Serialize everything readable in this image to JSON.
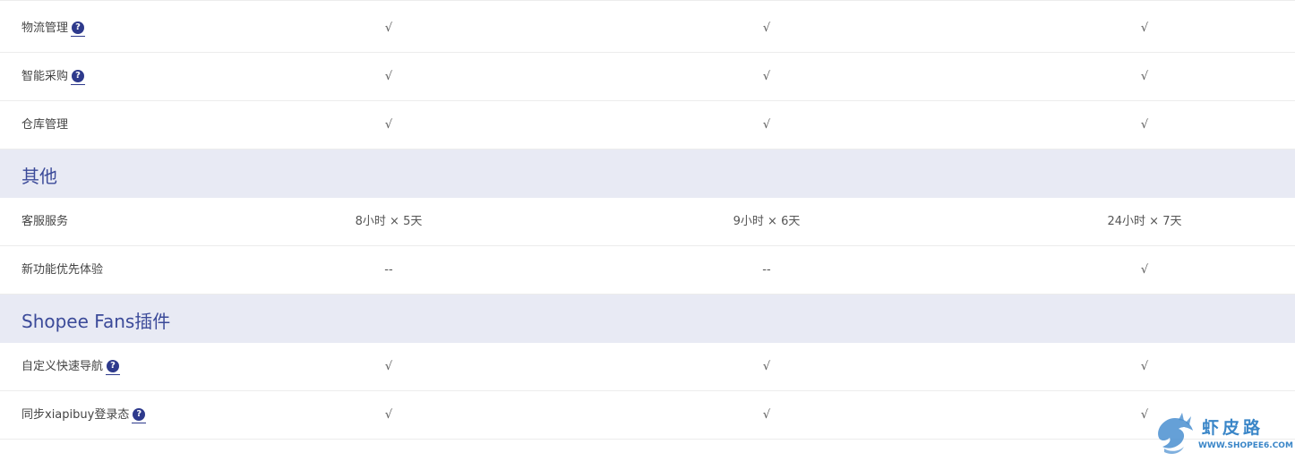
{
  "rows": [
    {
      "label": "物流管理",
      "help": "?",
      "c1": "√",
      "c2": "√",
      "c3": "√"
    },
    {
      "label": "智能采购",
      "help": "?",
      "c1": "√",
      "c2": "√",
      "c3": "√"
    },
    {
      "label": "仓库管理",
      "c1": "√",
      "c2": "√",
      "c3": "√"
    }
  ],
  "section_other": {
    "title": "其他"
  },
  "rows_other": [
    {
      "label": "客服服务",
      "c1": "8小时 × 5天",
      "c2": "9小时 × 6天",
      "c3": "24小时 × 7天"
    },
    {
      "label": "新功能优先体验",
      "c1": "--",
      "c2": "--",
      "c3": "√"
    }
  ],
  "section_plugin": {
    "title": "Shopee Fans插件"
  },
  "rows_plugin": [
    {
      "label": "自定义快速导航",
      "help": "?",
      "c1": "√",
      "c2": "√",
      "c3": "√"
    },
    {
      "label": "同步xiapibuy登录态",
      "help": "?",
      "c1": "√",
      "c2": "√",
      "c3": "√"
    }
  ],
  "watermark": {
    "text": "虾皮路",
    "url": "WWW.SHOPEE6.COM",
    "icon": "dragon-logo-icon"
  },
  "colors": {
    "section_bg": "#e8eaf4",
    "section_text": "#3b4a99",
    "help_icon": "#2e3a8c",
    "watermark": "#3a86c8"
  }
}
